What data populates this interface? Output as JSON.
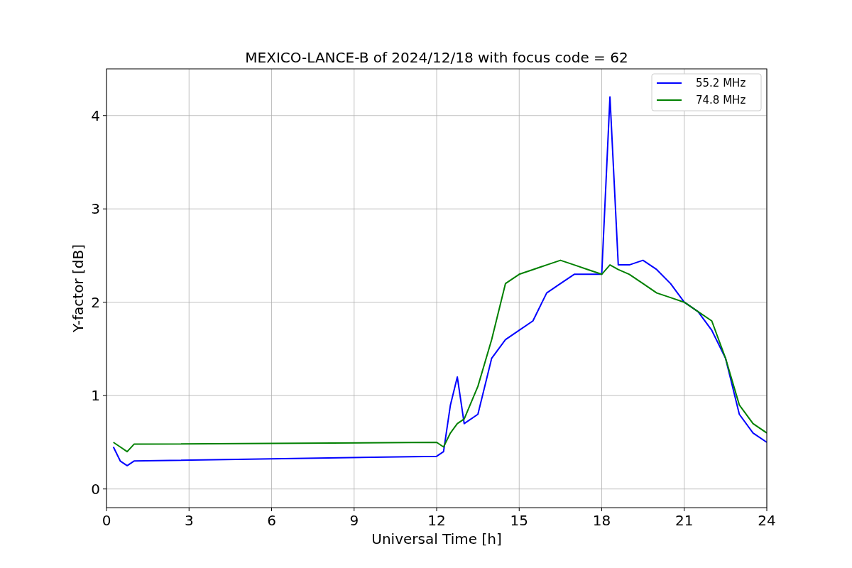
{
  "figure": {
    "chart_data": {
      "type": "line",
      "title": "MEXICO-LANCE-B of 2024/12/18 with focus code = 62",
      "xlabel": "Universal Time [h]",
      "ylabel": "Y-factor [dB]",
      "x": [
        0.25,
        0.5,
        0.75,
        1.0,
        12.0,
        12.25,
        12.5,
        12.75,
        13,
        13.5,
        14,
        14.5,
        15,
        15.5,
        16,
        16.5,
        17,
        17.5,
        18,
        18.3,
        18.6,
        19,
        19.5,
        20,
        20.5,
        21,
        21.5,
        22,
        22.5,
        23,
        23.5,
        24
      ],
      "series": [
        {
          "name": "55.2 MHz",
          "color": "#0000ff",
          "values": [
            0.45,
            0.3,
            0.25,
            0.3,
            0.35,
            0.4,
            0.9,
            1.2,
            0.7,
            0.8,
            1.4,
            1.6,
            1.7,
            1.8,
            2.1,
            2.2,
            2.3,
            2.3,
            2.3,
            4.2,
            2.4,
            2.4,
            2.45,
            2.35,
            2.2,
            2.0,
            1.9,
            1.7,
            1.4,
            0.8,
            0.6,
            0.5
          ]
        },
        {
          "name": "74.8 MHz",
          "color": "#008000",
          "values": [
            0.5,
            0.45,
            0.4,
            0.48,
            0.5,
            0.45,
            0.6,
            0.7,
            0.75,
            1.1,
            1.6,
            2.2,
            2.3,
            2.35,
            2.4,
            2.45,
            2.4,
            2.35,
            2.3,
            2.4,
            2.35,
            2.3,
            2.2,
            2.1,
            2.05,
            2.0,
            1.9,
            1.8,
            1.4,
            0.9,
            0.7,
            0.6
          ]
        }
      ],
      "grid": true,
      "legend": "upper right",
      "xlim": [
        0,
        24
      ],
      "ylim": [
        -0.2,
        4.5
      ],
      "xticks": [
        0,
        3,
        6,
        9,
        12,
        15,
        18,
        21,
        24
      ],
      "yticks": [
        0,
        1,
        2,
        3,
        4
      ]
    }
  }
}
